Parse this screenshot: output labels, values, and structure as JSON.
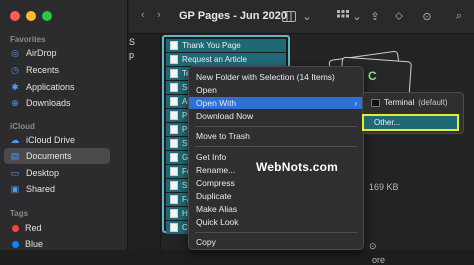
{
  "window": {
    "title": "GP Pages - Jun 2020"
  },
  "sidebar": {
    "favorites_title": "Favorites",
    "favorites": [
      {
        "label": "AirDrop",
        "icon": "airdrop-icon"
      },
      {
        "label": "Recents",
        "icon": "clock-icon"
      },
      {
        "label": "Applications",
        "icon": "applications-icon"
      },
      {
        "label": "Downloads",
        "icon": "downloads-icon"
      }
    ],
    "icloud_title": "iCloud",
    "icloud": [
      {
        "label": "iCloud Drive",
        "icon": "cloud-icon"
      },
      {
        "label": "Documents",
        "icon": "document-icon",
        "selected": true
      },
      {
        "label": "Desktop",
        "icon": "desktop-icon"
      },
      {
        "label": "Shared",
        "icon": "shared-folder-icon"
      }
    ],
    "tags_title": "Tags",
    "tags": [
      {
        "label": "Red",
        "color": "#ff453a"
      },
      {
        "label": "Blue",
        "color": "#0a84ff"
      }
    ]
  },
  "column1": {
    "fragments": [
      "S",
      "p"
    ]
  },
  "files": [
    {
      "label": "Thank You Page"
    },
    {
      "label": "Request an Article"
    },
    {
      "label": "Te"
    },
    {
      "label": "Se"
    },
    {
      "label": "Ac"
    },
    {
      "label": "Pr"
    },
    {
      "label": "Pr"
    },
    {
      "label": "Su"
    },
    {
      "label": "Ge"
    },
    {
      "label": "Fe"
    },
    {
      "label": "Sh"
    },
    {
      "label": "Fa"
    },
    {
      "label": "Ho"
    },
    {
      "label": "Co"
    }
  ],
  "context_menu": {
    "items": [
      {
        "label": "New Folder with Selection (14 Items)"
      },
      {
        "label": "Open"
      },
      {
        "label": "Open With",
        "submenu": true,
        "highlighted": true
      },
      {
        "label": "Download Now"
      },
      {
        "label": "Move to Trash"
      },
      {
        "label": "Get Info"
      },
      {
        "label": "Rename..."
      },
      {
        "label": "Compress"
      },
      {
        "label": "Duplicate"
      },
      {
        "label": "Make Alias"
      },
      {
        "label": "Quick Look"
      },
      {
        "label": "Copy"
      }
    ]
  },
  "submenu": {
    "terminal_label": "Terminal",
    "terminal_default": "(default)",
    "other_label": "Other..."
  },
  "preview": {
    "letter": "C",
    "size": "169 KB",
    "more_label": "ore"
  },
  "watermark": "WebNots.com"
}
